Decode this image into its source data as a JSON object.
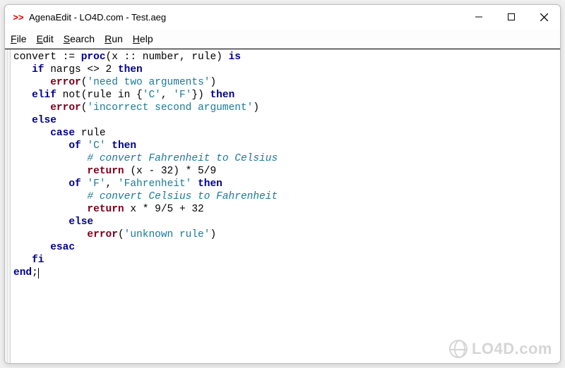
{
  "window": {
    "icon_text": ">>",
    "title": "AgenaEdit - LO4D.com - Test.aeg"
  },
  "menu": {
    "file": {
      "u": "F",
      "rest": "ile"
    },
    "edit": {
      "u": "E",
      "rest": "dit"
    },
    "search": {
      "u": "S",
      "rest": "earch"
    },
    "run": {
      "u": "R",
      "rest": "un"
    },
    "help": {
      "u": "H",
      "rest": "elp"
    }
  },
  "code": {
    "l1_a": "convert := ",
    "l1_kw": "proc",
    "l1_b": "(x :: number, rule) ",
    "l1_is": "is",
    "l2_if": "if",
    "l2_a": " nargs <> 2 ",
    "l2_then": "then",
    "l3_err": "error",
    "l3_s": "'need two arguments'",
    "l4_elif": "elif",
    "l4_a": " not(rule in {",
    "l4_s1": "'C'",
    "l4_b": ", ",
    "l4_s2": "'F'",
    "l4_c": "}) ",
    "l4_then": "then",
    "l5_err": "error",
    "l5_s": "'incorrect second argument'",
    "l6_else": "else",
    "l7_case": "case",
    "l7_a": " rule",
    "l8_of": "of",
    "l8_sp": " ",
    "l8_s": "'C'",
    "l8_sp2": " ",
    "l8_then": "then",
    "l9_com": "# convert Fahrenheit to Celsius",
    "l10_ret": "return",
    "l10_a": " (x - 32) * 5/9",
    "l11_of": "of",
    "l11_sp": " ",
    "l11_s1": "'F'",
    "l11_b": ", ",
    "l11_s2": "'Fahrenheit'",
    "l11_sp2": " ",
    "l11_then": "then",
    "l12_com": "# convert Celsius to Fahrenheit",
    "l13_ret": "return",
    "l13_a": " x * 9/5 + 32",
    "l14_else": "else",
    "l15_err": "error",
    "l15_s": "'unknown rule'",
    "l16_esac": "esac",
    "l17_fi": "fi",
    "l18_end": "end",
    "l18_semi": ";"
  },
  "watermark": {
    "text": "LO4D.com"
  }
}
